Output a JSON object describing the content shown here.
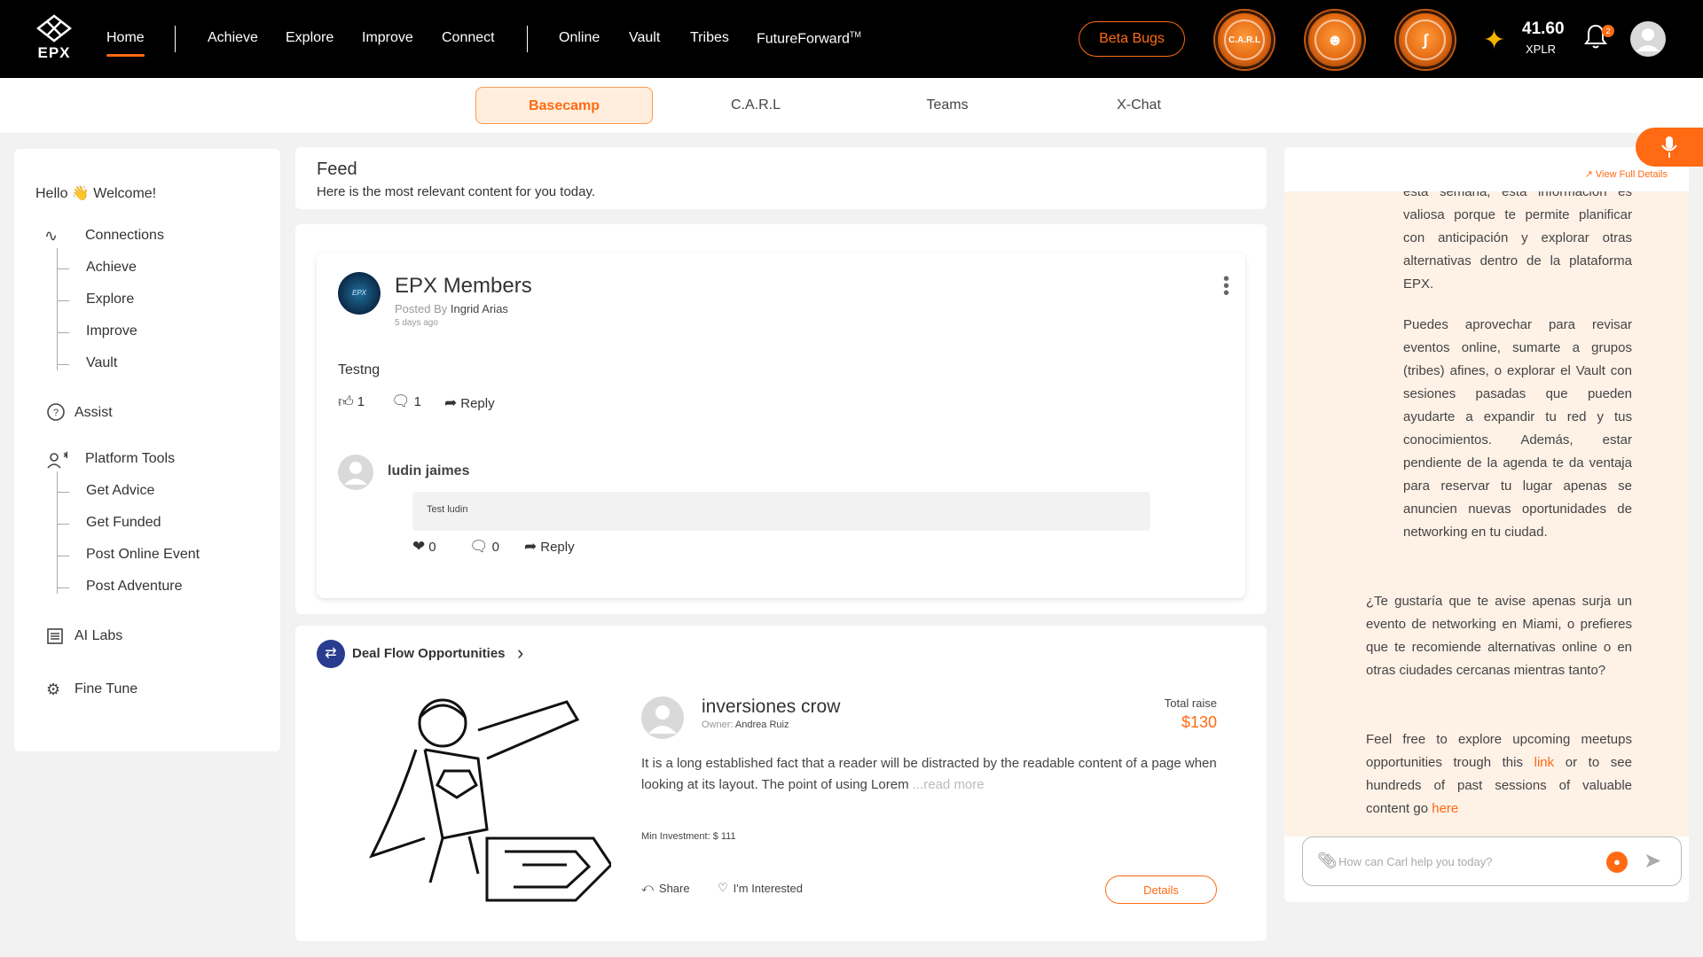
{
  "header": {
    "logo_text": "EPX",
    "nav": [
      {
        "label": "Home"
      },
      {
        "label": "Achieve"
      },
      {
        "label": "Explore"
      },
      {
        "label": "Improve"
      },
      {
        "label": "Connect"
      },
      {
        "label": "Online"
      },
      {
        "label": "Vault"
      },
      {
        "label": "Tribes"
      },
      {
        "label": "FutureForward"
      }
    ],
    "tm_mark": "TM",
    "beta_button": "Beta Bugs",
    "orbs": [
      {
        "label": "C.A.R.L",
        "icon": "carl-icon"
      },
      {
        "label": "",
        "icon": "people-icon"
      },
      {
        "label": "",
        "icon": "dna-icon"
      }
    ],
    "xplr_value": "41.60",
    "xplr_unit": "XPLR",
    "notifications_count": "2"
  },
  "subtabs": [
    {
      "label": "Basecamp",
      "active": true
    },
    {
      "label": "C.A.R.L"
    },
    {
      "label": "Teams"
    },
    {
      "label": "X-Chat"
    }
  ],
  "sidebar": {
    "greeting": "Hello 👋 Welcome!",
    "connections": "Connections",
    "connections_children": [
      "Achieve",
      "Explore",
      "Improve",
      "Vault"
    ],
    "assist": "Assist",
    "platform_tools": "Platform Tools",
    "platform_children": [
      "Get Advice",
      "Get Funded",
      "Post Online Event",
      "Post Adventure"
    ],
    "ai_labs": "AI Labs",
    "fine_tune": "Fine Tune"
  },
  "feed": {
    "title": "Feed",
    "subtitle": "Here is the most relevant content for you today."
  },
  "post": {
    "group_avatar_text": "EPX MEMBERS",
    "group_name": "EPX Members",
    "posted_by_label": "Posted By",
    "author": "Ingrid Arias",
    "time": "5 days ago",
    "text": "Testng",
    "likes": "1",
    "comments": "1",
    "reply_label": "Reply",
    "comment": {
      "author": "ludin jaimes",
      "text": "Test ludin",
      "likes": "0",
      "replies": "0",
      "reply_label": "Reply"
    }
  },
  "deal": {
    "section_title": "Deal Flow Opportunities",
    "name": "inversiones crow",
    "owner_label": "Owner:",
    "owner": "Andrea Ruiz",
    "total_raise_label": "Total raise",
    "total_raise": "$130",
    "description": "It is a long established fact that a reader will be distracted by the readable content of a page when looking at its layout. The point of using Lorem ",
    "read_more": "...read more",
    "min_investment": "Min Investment: $ 111",
    "share_label": "Share",
    "interested_label": "I'm Interested",
    "details_button": "Details"
  },
  "chat": {
    "view_full": "View Full Details",
    "para1": "esta semana, esta información es valiosa porque te permite planificar con anticipación y explorar otras alternativas dentro de la plataforma EPX.",
    "para2": "Puedes aprovechar para revisar eventos online, sumarte a grupos (tribes) afines, o explorar el Vault con sesiones pasadas que pueden ayudarte a expandir tu red y tus conocimientos. Además, estar pendiente de la agenda te da ventaja para reservar tu lugar apenas se anuncien nuevas oportunidades de networking en tu ciudad.",
    "para3": "¿Te gustaría que te avise apenas surja un evento de networking en Miami, o prefieres que te recomiende alternativas online o en otras ciudades cercanas mientras tanto?",
    "para4_a": "Feel free to explore upcoming meetups opportunities trough this ",
    "para4_link1": "link",
    "para4_b": " or to see hundreds of past sessions of valuable content go ",
    "para4_link2": "here",
    "input_placeholder": "How can Carl help you today?"
  },
  "colors": {
    "accent": "#ff6a13",
    "topbar": "#000000",
    "chat_bg": "#fef1e6"
  }
}
